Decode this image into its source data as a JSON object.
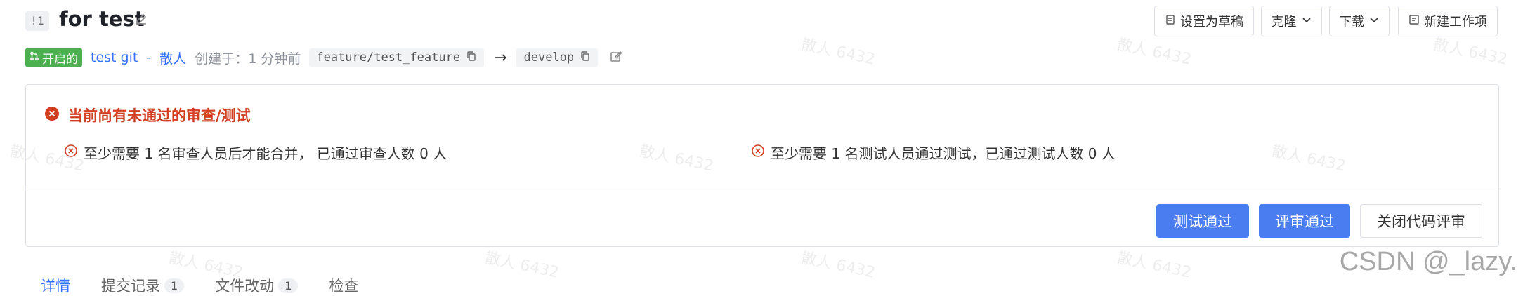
{
  "header": {
    "pr_number": "!1",
    "title": "for test",
    "buttons": {
      "set_draft": "设置为草稿",
      "clone": "克隆",
      "download": "下载",
      "new_work_item": "新建工作项"
    }
  },
  "meta": {
    "status": "开启的",
    "repo": "test git",
    "separator": "-",
    "author": "散人",
    "created_label": "创建于：1 分钟前",
    "source_branch": "feature/test_feature",
    "arrow": "→",
    "target_branch": "develop"
  },
  "review": {
    "alert_title": "当前尚有未通过的审查/测试",
    "requirement_review": "至少需要 1 名审查人员后才能合并， 已通过审查人数 0 人",
    "requirement_test": "至少需要 1 名测试人员通过测试，已通过测试人数 0 人",
    "buttons": {
      "test_pass": "测试通过",
      "review_pass": "评审通过",
      "close_review": "关闭代码评审"
    }
  },
  "tabs": [
    {
      "label": "详情",
      "count": null
    },
    {
      "label": "提交记录",
      "count": "1"
    },
    {
      "label": "文件改动",
      "count": "1"
    },
    {
      "label": "检查",
      "count": null
    }
  ],
  "watermark": {
    "csdn": "CSDN @_lazy.",
    "text": "散人 6432"
  },
  "colors": {
    "primary": "#4a7df0",
    "link": "#3370ff",
    "status_green": "#4caf50",
    "error_red": "#d23f20"
  }
}
